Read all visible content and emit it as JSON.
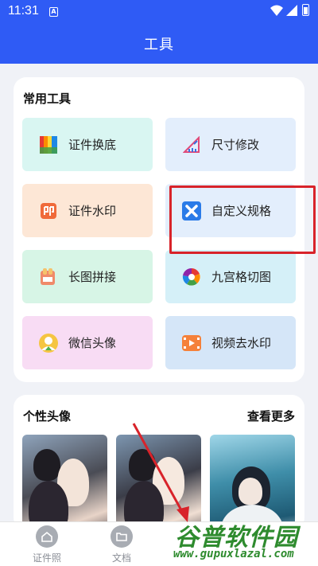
{
  "status_bar": {
    "time": "11:31",
    "sim_label": "A"
  },
  "header": {
    "title": "工具"
  },
  "tools_section": {
    "title": "常用工具",
    "items": [
      {
        "label": "证件换底",
        "icon": "color-palette-icon"
      },
      {
        "label": "尺寸修改",
        "icon": "ruler-resize-icon"
      },
      {
        "label": "证件水印",
        "icon": "stamp-icon"
      },
      {
        "label": "自定义规格",
        "icon": "custom-spec-icon"
      },
      {
        "label": "长图拼接",
        "icon": "image-stitch-icon"
      },
      {
        "label": "九宫格切图",
        "icon": "aperture-grid-icon"
      },
      {
        "label": "微信头像",
        "icon": "wechat-avatar-icon"
      },
      {
        "label": "视频去水印",
        "icon": "video-watermark-icon"
      }
    ]
  },
  "avatar_section": {
    "title": "个性头像",
    "more_label": "查看更多"
  },
  "bottom_nav": [
    {
      "label": "证件照",
      "icon": "home-icon"
    },
    {
      "label": "文档",
      "icon": "folder-icon"
    }
  ],
  "watermark": {
    "text": "谷普软件园",
    "url": "www.gupuxlazal.com"
  },
  "colors": {
    "primary": "#2f5bf5",
    "highlight": "#d8232a",
    "watermark": "#2e8b2e"
  }
}
